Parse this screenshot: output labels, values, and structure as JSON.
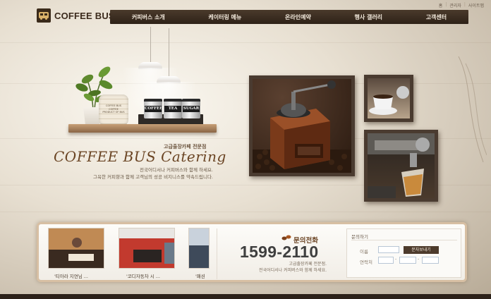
{
  "utility": {
    "links": [
      "홈",
      "관리자",
      "사이트맵"
    ]
  },
  "logo": {
    "text": "COFFEE BUS",
    "subtext": ""
  },
  "nav": {
    "items": [
      "커피버스 소개",
      "케이터링 메뉴",
      "온라인예약",
      "행사 갤러리",
      "고객센터"
    ]
  },
  "shelf": {
    "cask_label": "COFFEE BUS\nCOFFEE\nPRODUCT OF BUS",
    "cans": [
      "COFFEE",
      "TEA",
      "SUGAR"
    ]
  },
  "hero": {
    "tagline": "고급출장카페 전문점",
    "headline": "COFFEE BUS Catering",
    "desc_line1": "전국어디서나 커피버스와 함께 하세요.",
    "desc_line2": "그윽한 커피향과 함께 고객님의 성공 비지니스를 약속드립니다."
  },
  "gallery": {
    "items": [
      {
        "caption": "'티아라 지연님 ...",
        "color": "#8a5a3a"
      },
      {
        "caption": "'코디자동차 시 ...",
        "color": "#b5322a"
      },
      {
        "caption": "'패션",
        "color": "#3e4a5a"
      }
    ]
  },
  "contact": {
    "title": "문의전화",
    "phone": "1599-2110",
    "desc_line1": "고급출장카페 전문점.",
    "desc_line2": "전국어디서나 커피버스와 함께 하세요."
  },
  "inquiry": {
    "title": "문의하기",
    "name_label": "이름",
    "phone_label": "연락처",
    "button_label": "문자보내기",
    "dash": "-"
  },
  "colors": {
    "brand_brown": "#3b2a1c",
    "nav_bg": "#2e2218",
    "accent": "#6a4423"
  }
}
